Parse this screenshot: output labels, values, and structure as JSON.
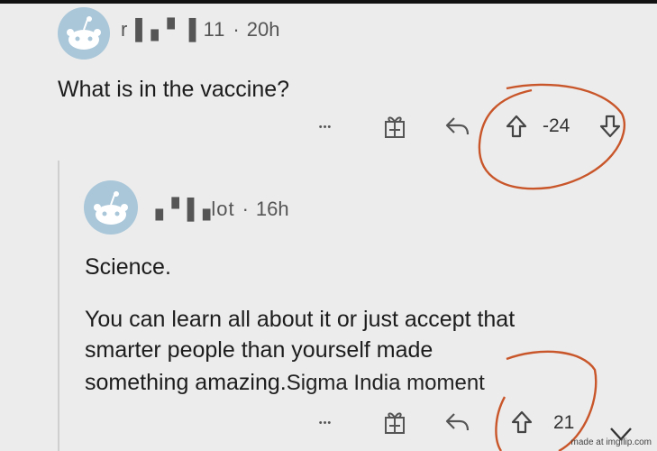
{
  "post": {
    "username": "r▐▗▝ ▐ 11",
    "time": "20h",
    "title": "What is in the vaccine?",
    "more": "•••",
    "score": "-24"
  },
  "reply": {
    "username": "▗▝▐▗lot",
    "time": "16h",
    "line1": "Science.",
    "line2": "You can learn all about it or just accept that",
    "line3": "smarter people than yourself made",
    "line4": "something amazing.",
    "overlay": "Sigma India moment",
    "more": "•••",
    "score": "21"
  },
  "separator": "·",
  "watermark": "made at imgflip.com",
  "colors": {
    "circle": "#c8562a",
    "avatar": "#a9c7d9",
    "background": "#ececec"
  }
}
